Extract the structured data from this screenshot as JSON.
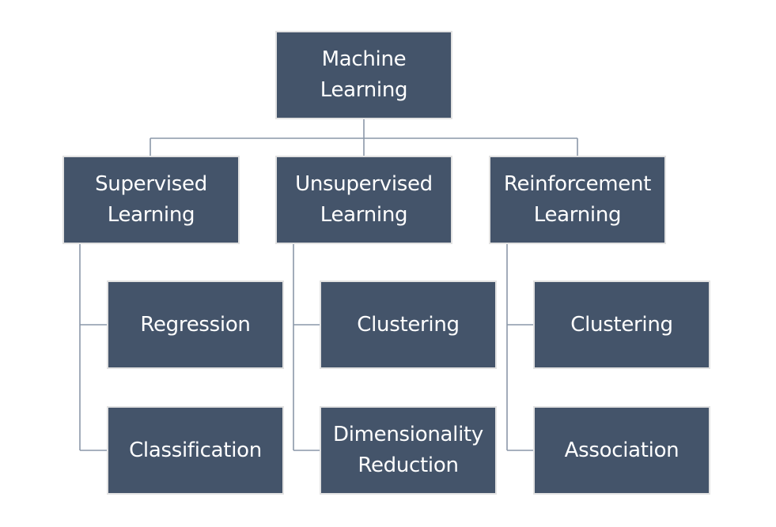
{
  "root": {
    "label": "Machine\nLearning"
  },
  "categories": [
    {
      "label": "Supervised\nLearning",
      "children": [
        "Regression",
        "Classification"
      ]
    },
    {
      "label": "Unsupervised\nLearning",
      "children": [
        "Clustering",
        "Dimensionality\nReduction"
      ]
    },
    {
      "label": "Reinforcement\nLearning",
      "children": [
        "Clustering",
        "Association"
      ]
    }
  ],
  "colors": {
    "box_fill": "#44546a",
    "box_border": "#e2e2e2",
    "connector": "#8a97a8",
    "text": "#ffffff"
  }
}
